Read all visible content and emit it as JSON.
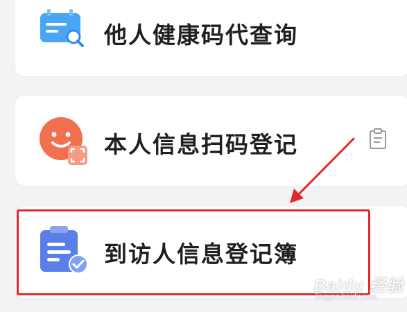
{
  "menu": {
    "items": [
      {
        "label": "他人健康码代查询",
        "icon": "calendar-search-icon"
      },
      {
        "label": "本人信息扫码登记",
        "icon": "smiley-scan-icon",
        "trailing_icon": "clipboard-icon"
      },
      {
        "label": "到访人信息登记簿",
        "icon": "clipboard-check-icon",
        "highlighted": true
      }
    ]
  },
  "watermark": {
    "main": "Baidu 经验",
    "sub": "jingyan.baidu.com"
  },
  "colors": {
    "highlight": "#e3262b",
    "calendar_icon": "#4aa5f5",
    "smiley_icon": "#f07050",
    "clipboard_icon": "#5b7ee8",
    "check_badge": "#7fa3f2",
    "background": "#f2f3f5",
    "card": "#ffffff"
  }
}
